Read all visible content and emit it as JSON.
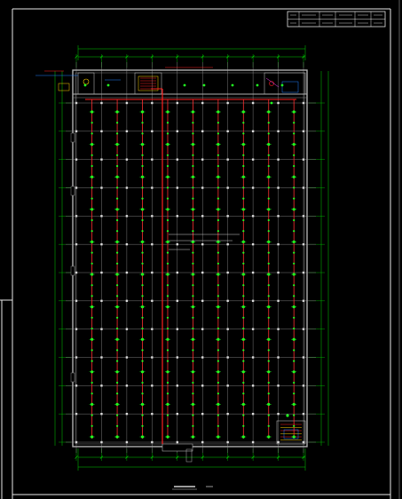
{
  "drawing": {
    "plan_title": "",
    "plan_scale": "",
    "center_note_lines": [
      "",
      "",
      ""
    ],
    "title_block_cells": [
      "",
      "",
      "",
      "",
      "",
      "",
      "",
      "",
      ""
    ],
    "grid": {
      "columns": 9,
      "rows": 12,
      "head_rows": 11,
      "heads_per_bay_col": 1,
      "heads_per_bay_row": 3
    },
    "colors": {
      "background": "#000000",
      "frame_inner": "#ffffff",
      "frame_outer": "#f0f0f0",
      "grid_line": "#7a7a7a",
      "dimension": "#00d000",
      "wall": "#b0b0b0",
      "pipe_main": "#ff2020",
      "pipe_branch": "#ff3030",
      "sprinkler_head": "#20ff20",
      "detail": "#ffd000",
      "accent": "#2080ff",
      "magenta": "#ff40ff"
    }
  }
}
